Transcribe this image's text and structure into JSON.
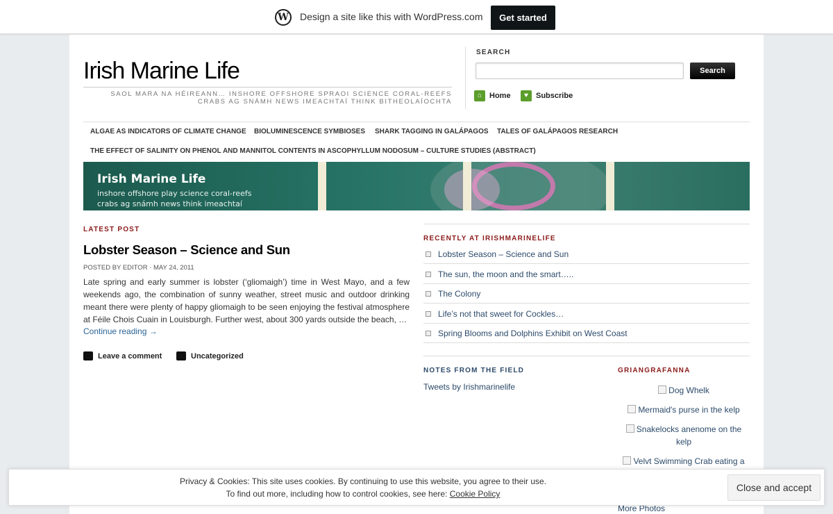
{
  "wpbar": {
    "logo_glyph": "W",
    "text": "Design a site like this with WordPress.com",
    "cta": "Get started"
  },
  "header": {
    "site_title": "Irish Marine Life",
    "tagline": "SAOL MARA NA HÉIREANN… INSHORE OFFSHORE SPRAOI SCIENCE CORAL-REEFS CRABS AG SNÁMH NEWS IMEACHTAÍ THINK BITHEOLAÍOCHTA",
    "search_label": "SEARCH",
    "search_value": "",
    "search_button": "Search",
    "home_link": "Home",
    "subscribe_link": "Subscribe",
    "home_icon": "home-icon",
    "subscribe_icon": "heart-icon"
  },
  "nav": {
    "items": [
      "ALGAE AS INDICATORS OF CLIMATE CHANGE",
      "BIOLUMINESCENCE SYMBIOSES",
      "SHARK TAGGING IN GALÁPAGOS",
      "TALES OF GALÁPAGOS RESEARCH",
      "THE EFFECT OF SALINITY ON PHENOL AND MANNITOL CONTENTS IN ASCOPHYLLUM NODOSUM – CULTURE STUDIES (ABSTRACT)"
    ]
  },
  "banner": {
    "title": "Irish Marine Life",
    "sub_line1": "inshore offshore play science coral-reefs",
    "sub_line2": "crabs ag snámh news think imeachtaí"
  },
  "post": {
    "section_label": "LATEST POST",
    "title": "Lobster Season – Science and Sun",
    "meta": "POSTED BY EDITOR · MAY 24, 2011",
    "excerpt": "Late spring and early summer is lobster (‘gliomaigh’) time in West Mayo, and a few weekends ago, the combination of sunny weather, street music and outdoor drinking meant there were plenty of happy gliomaigh to be seen enjoying the festival atmosphere at Féile Chois Cuain in Louisburgh. Further west, about 300 yards outside the beach, …",
    "continue": "Continue reading →",
    "comment_link": "Leave a comment",
    "category_link": "Uncategorized"
  },
  "sidebar": {
    "recent_label": "RECENTLY AT IRISHMARINELIFE",
    "recent": [
      "Lobster Season – Science and Sun",
      "The sun, the moon and the smart…..",
      "The Colony",
      "Life’s not that sweet for Cockles…",
      "Spring Blooms and Dolphins Exhibit on West Coast"
    ],
    "notes_label": "NOTES FROM THE FIELD",
    "tweets": "Tweets by Irishmarinelife",
    "photos_label": "GRIANGRAFANNA",
    "photos": [
      "Dog Whelk",
      "Mermaid's purse in the kelp",
      "Snakelocks anenome on the kelp",
      "Velvt Swimming Crab eating a"
    ],
    "more_photos": "More Photos"
  },
  "cookie": {
    "line1": "Privacy & Cookies: This site uses cookies. By continuing to use this website, you agree to their use.",
    "line2": "To find out more, including how to control cookies, see here:",
    "policy_link": "Cookie Policy",
    "button": "Close and accept"
  },
  "colors": {
    "accent_red": "#8b1a1a",
    "link_blue": "#2c4a6a",
    "icon_green": "#5b9e2b"
  }
}
